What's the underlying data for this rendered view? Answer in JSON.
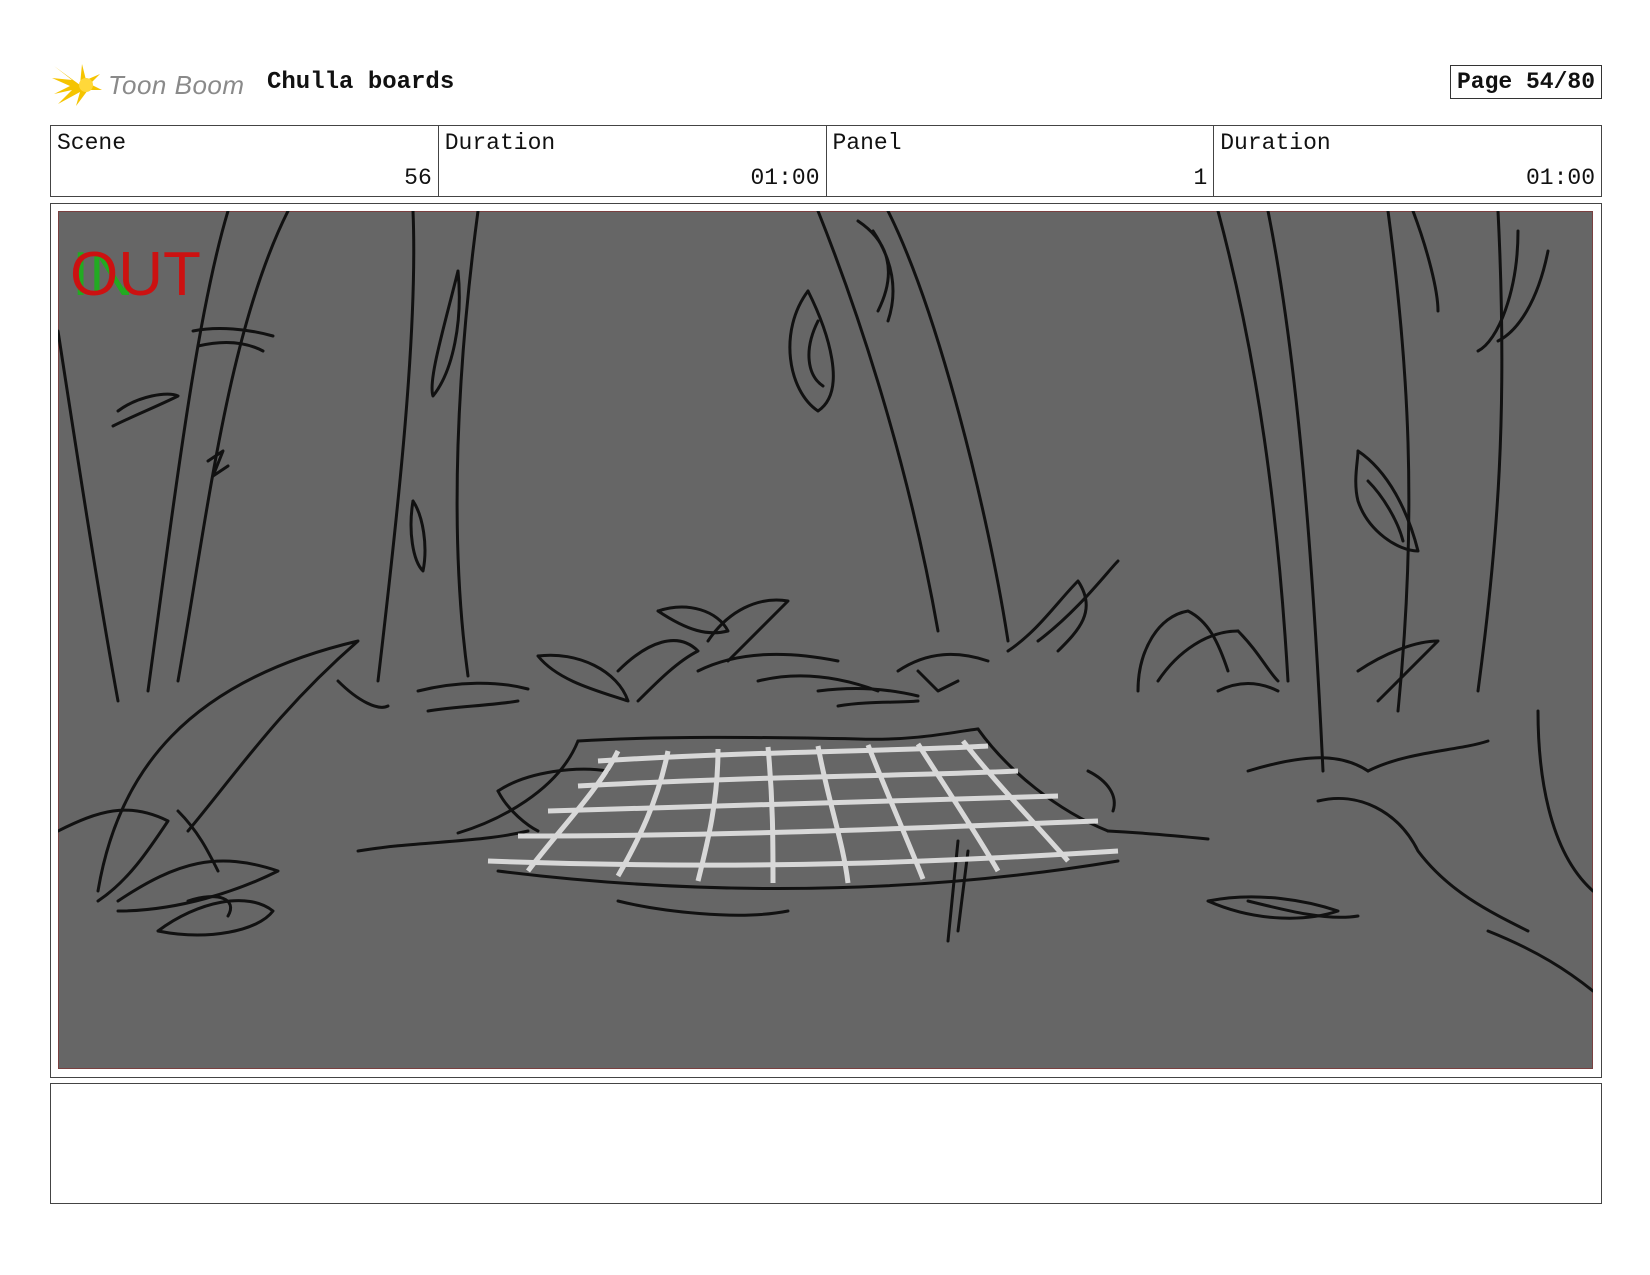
{
  "header": {
    "logo_text": "Toon Boom",
    "project_title": "Chulla boards",
    "page_label": "Page 54/80"
  },
  "info": {
    "scene_label": "Scene",
    "scene_value": "56",
    "scene_duration_label": "Duration",
    "scene_duration_value": "01:00",
    "panel_label": "Panel",
    "panel_value": "1",
    "panel_duration_label": "Duration",
    "panel_duration_value": "01:00"
  },
  "panel": {
    "overlay_out": "OUT",
    "overlay_in": "IN"
  },
  "notes": {
    "text": ""
  },
  "colors": {
    "panel_bg": "#666666",
    "sketch_line": "#111111",
    "out_red": "#cc1111",
    "in_green": "#22aa22",
    "logo_yellow": "#f5c400"
  }
}
